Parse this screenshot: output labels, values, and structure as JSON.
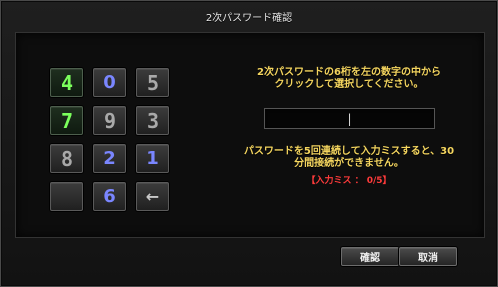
{
  "title": "2次パスワード確認",
  "instruction": {
    "line1": "2次パスワードの6桁を左の数字の中から",
    "line2": "クリックして選択してください。"
  },
  "password_field": {
    "value": "|"
  },
  "warning": {
    "line1": "パスワードを5回連続して入力ミスすると、30",
    "line2": "分間接続ができません。"
  },
  "fail_count": "【入力ミス ： 0/5】",
  "keypad": {
    "keys": [
      {
        "label": "4",
        "style": "green"
      },
      {
        "label": "0",
        "style": "blue"
      },
      {
        "label": "5",
        "style": "grey"
      },
      {
        "label": "7",
        "style": "green"
      },
      {
        "label": "9",
        "style": "grey"
      },
      {
        "label": "3",
        "style": "grey"
      },
      {
        "label": "8",
        "style": "grey"
      },
      {
        "label": "2",
        "style": "blue"
      },
      {
        "label": "1",
        "style": "blue"
      },
      {
        "label": "",
        "style": "empty"
      },
      {
        "label": "6",
        "style": "blue"
      },
      {
        "label": "←",
        "style": "backspace"
      }
    ]
  },
  "buttons": {
    "ok": "確認",
    "cancel": "取消"
  }
}
